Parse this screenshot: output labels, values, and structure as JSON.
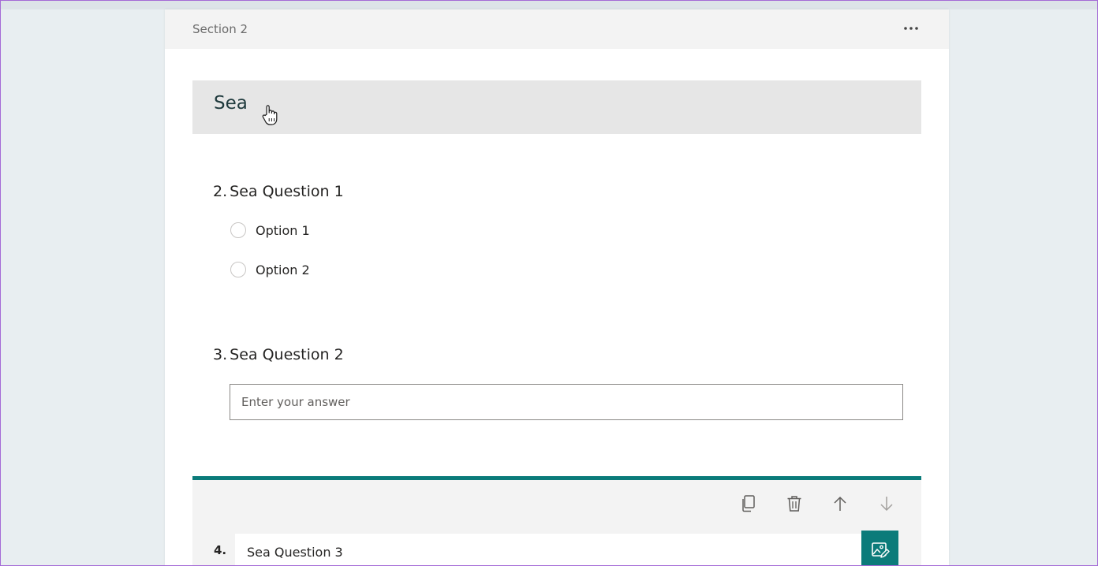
{
  "section": {
    "label": "Section 2",
    "title": "Sea"
  },
  "questions": [
    {
      "number": "2.",
      "text": "Sea Question 1",
      "options": [
        "Option 1",
        "Option 2"
      ]
    },
    {
      "number": "3.",
      "text": "Sea Question 2",
      "placeholder": "Enter your answer"
    }
  ],
  "active_question": {
    "number": "4.",
    "value": "Sea Question 3"
  },
  "icons": {
    "more": "more-icon",
    "copy": "copy-icon",
    "delete": "trash-icon",
    "move_up": "arrow-up-icon",
    "move_down": "arrow-down-icon",
    "media": "insert-media-icon"
  },
  "colors": {
    "accent": "#0b7b7a",
    "background": "#e8eef1",
    "section_header_bg": "#f3f3f3",
    "title_box_bg": "#e6e6e6"
  }
}
